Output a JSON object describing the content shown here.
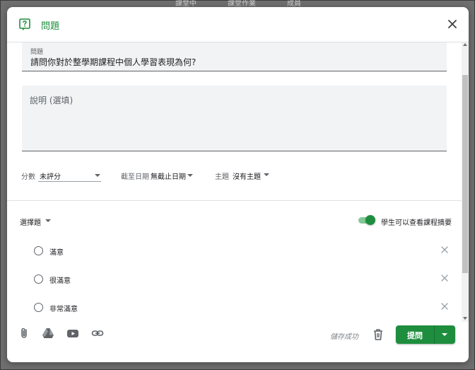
{
  "background_tabs": [
    "課堂中",
    "課堂作業",
    "成員"
  ],
  "header": {
    "title": "問題",
    "icon": "question-icon",
    "close_icon": "close-icon"
  },
  "question": {
    "label": "問題",
    "value": "請問你對於整學期課程中個人學習表現為何?"
  },
  "description": {
    "placeholder": "說明 (選填)"
  },
  "grading": {
    "label": "分數",
    "value": "未評分"
  },
  "due": {
    "label": "截至日期",
    "value": "無截止日期"
  },
  "topic": {
    "label": "主題",
    "value": "沒有主題"
  },
  "question_type": {
    "value": "選擇題"
  },
  "student_summary": {
    "label": "學生可以查看課程摘要",
    "enabled": true
  },
  "options": [
    {
      "label": "滿意"
    },
    {
      "label": "很滿意"
    },
    {
      "label": "非常滿意"
    }
  ],
  "footer": {
    "icons": [
      "attach-icon",
      "google-drive-icon",
      "youtube-icon",
      "link-icon"
    ],
    "saved_status": "儲存成功",
    "assign_label": "提問"
  },
  "colors": {
    "accent": "#1e8e3e",
    "toggle_track": "#81c995"
  }
}
